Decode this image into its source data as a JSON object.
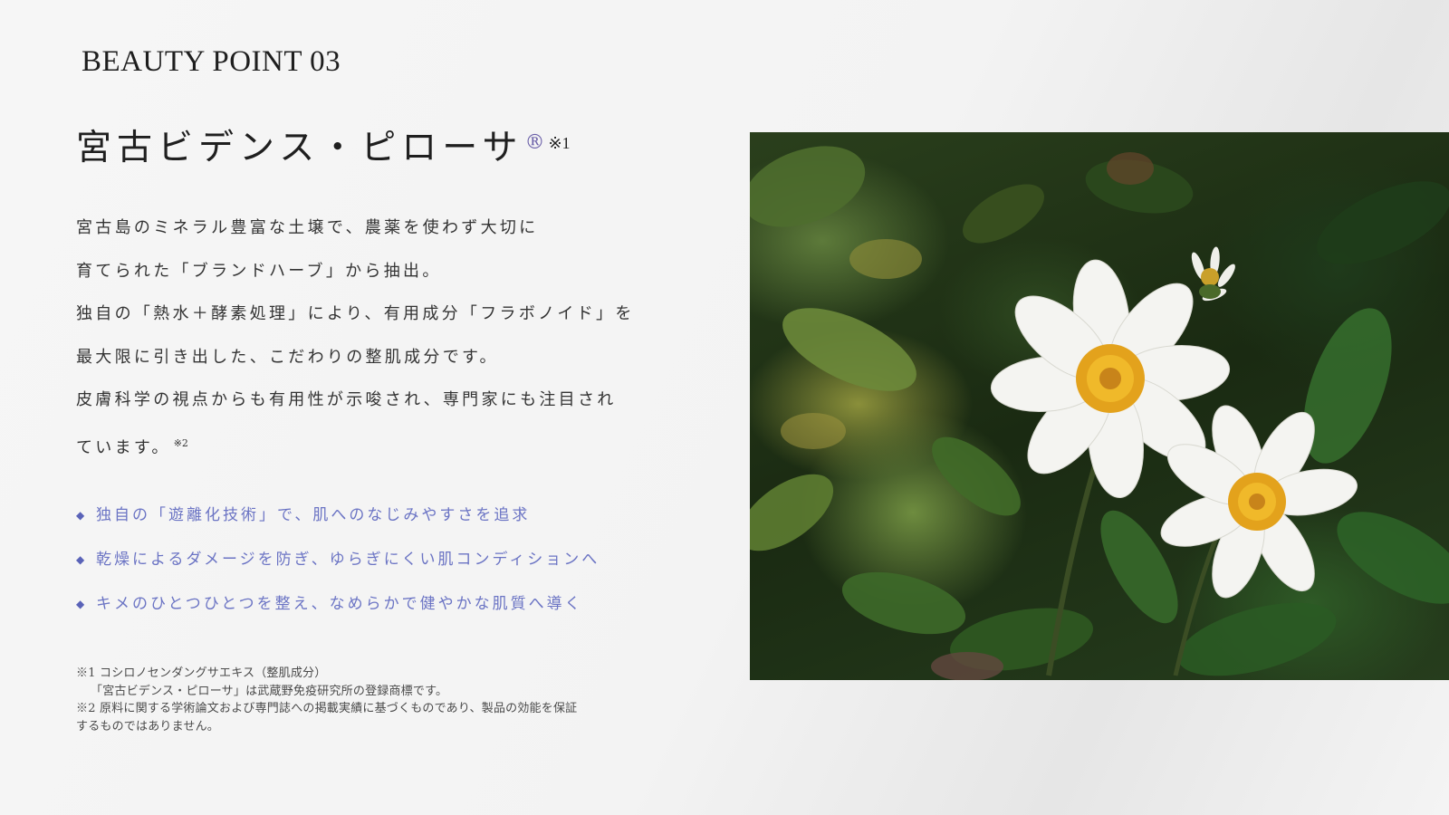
{
  "section_label": "BEAUTY POINT 03",
  "title": {
    "text": "宮古ビデンス・ピローサ",
    "registered_mark": "®",
    "note_mark": "※1"
  },
  "description": {
    "lines": [
      "宮古島のミネラル豊富な土壌で、農薬を使わず大切に",
      "育てられた「ブランドハーブ」から抽出。",
      "独自の「熱水＋酵素処理」により、有用成分「フラボノイド」を",
      "最大限に引き出した、こだわりの整肌成分です。",
      "皮膚科学の視点からも有用性が示唆され、専門家にも注目され",
      "ています。"
    ],
    "last_line_note": "※2"
  },
  "points": {
    "bullet": "◆",
    "items": [
      "独自の「遊離化技術」で、肌へのなじみやすさを追求",
      "乾燥によるダメージを防ぎ、ゆらぎにくい肌コンディションへ",
      "キメのひとつひとつを整え、なめらかで健やかな肌質へ導く"
    ]
  },
  "footnotes": [
    "※1 コシロノセンダングサエキス（整肌成分）",
    "「宮古ビデンス・ピローサ」は武蔵野免疫研究所の登録商標です。",
    "※2 原料に関する学術論文および専門誌への掲載実績に基づくものであり、製品の効能を保証",
    "するものではありません。"
  ],
  "colors": {
    "accent": "#6b74c4",
    "registered_mark": "#6a5fa8",
    "text": "#333333"
  }
}
